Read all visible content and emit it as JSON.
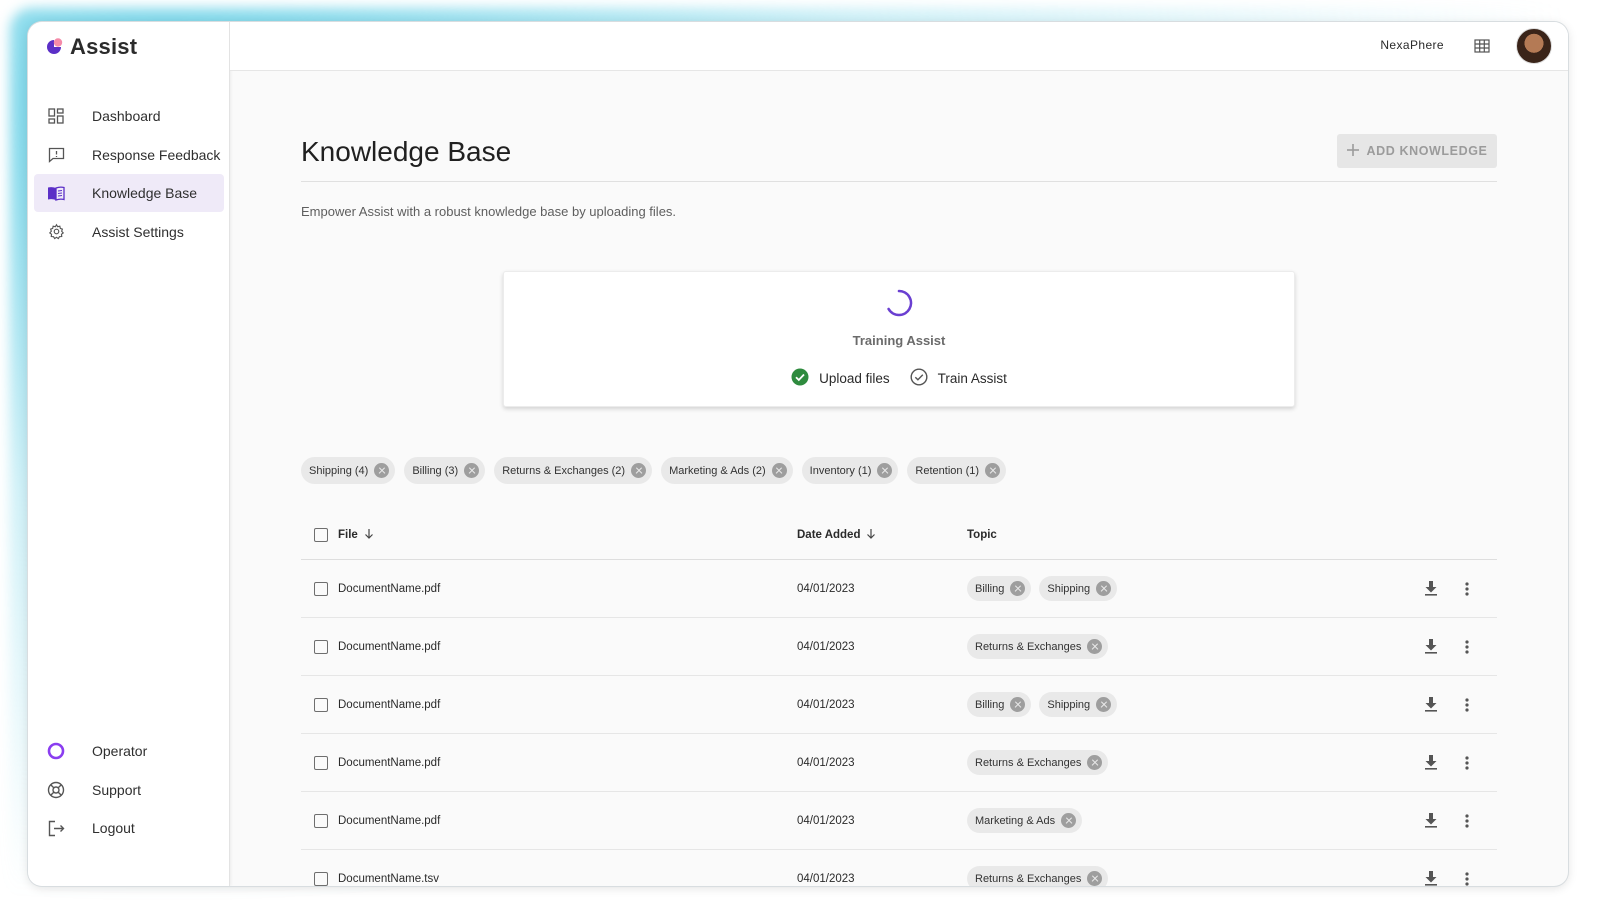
{
  "app": {
    "name": "Assist",
    "org_name": "NexaPhere",
    "brand_color": "#5b2fc7"
  },
  "sidebar": {
    "items": [
      {
        "label": "Dashboard",
        "icon": "dashboard-icon"
      },
      {
        "label": "Response Feedback",
        "icon": "feedback-icon"
      },
      {
        "label": "Knowledge Base",
        "icon": "book-icon",
        "active": true
      },
      {
        "label": "Assist Settings",
        "icon": "gear-icon"
      }
    ],
    "bottom_items": [
      {
        "label": "Operator",
        "icon": "operator-ring-icon"
      },
      {
        "label": "Support",
        "icon": "lifebuoy-icon"
      },
      {
        "label": "Logout",
        "icon": "logout-icon"
      }
    ]
  },
  "page": {
    "title": "Knowledge Base",
    "add_button": "ADD KNOWLEDGE",
    "subtitle": "Empower Assist with a robust knowledge base by uploading files."
  },
  "training": {
    "title": "Training Assist",
    "steps": [
      {
        "label": "Upload files",
        "status": "done"
      },
      {
        "label": "Train Assist",
        "status": "pending"
      }
    ]
  },
  "filters": [
    "Shipping (4)",
    "Billing (3)",
    "Returns & Exchanges (2)",
    "Marketing & Ads (2)",
    "Inventory (1)",
    "Retention (1)"
  ],
  "table": {
    "columns": {
      "file": "File",
      "date": "Date Added",
      "topic": "Topic"
    },
    "rows": [
      {
        "file": "DocumentName.pdf",
        "date": "04/01/2023",
        "topics": [
          "Billing",
          "Shipping"
        ]
      },
      {
        "file": "DocumentName.pdf",
        "date": "04/01/2023",
        "topics": [
          "Returns & Exchanges"
        ]
      },
      {
        "file": "DocumentName.pdf",
        "date": "04/01/2023",
        "topics": [
          "Billing",
          "Shipping"
        ]
      },
      {
        "file": "DocumentName.pdf",
        "date": "04/01/2023",
        "topics": [
          "Returns & Exchanges"
        ]
      },
      {
        "file": "DocumentName.pdf",
        "date": "04/01/2023",
        "topics": [
          "Marketing & Ads"
        ]
      },
      {
        "file": "DocumentName.tsv",
        "date": "04/01/2023",
        "topics": [
          "Returns & Exchanges"
        ]
      }
    ]
  }
}
